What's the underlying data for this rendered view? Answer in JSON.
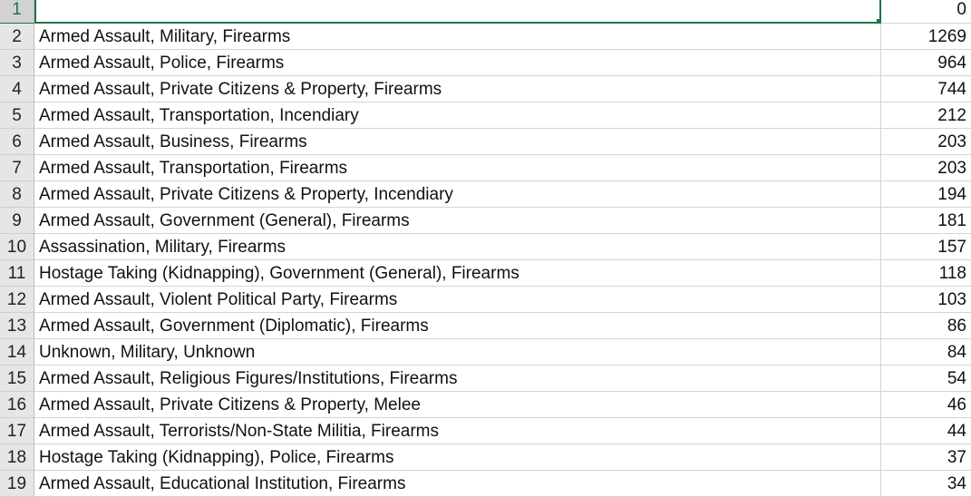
{
  "rows": [
    {
      "n": "1",
      "label": "",
      "value": "0"
    },
    {
      "n": "2",
      "label": "Armed Assault, Military, Firearms",
      "value": "1269"
    },
    {
      "n": "3",
      "label": "Armed Assault, Police, Firearms",
      "value": "964"
    },
    {
      "n": "4",
      "label": "Armed Assault, Private Citizens & Property, Firearms",
      "value": "744"
    },
    {
      "n": "5",
      "label": "Armed Assault, Transportation, Incendiary",
      "value": "212"
    },
    {
      "n": "6",
      "label": "Armed Assault, Business, Firearms",
      "value": "203"
    },
    {
      "n": "7",
      "label": "Armed Assault, Transportation, Firearms",
      "value": "203"
    },
    {
      "n": "8",
      "label": "Armed Assault, Private Citizens & Property, Incendiary",
      "value": "194"
    },
    {
      "n": "9",
      "label": "Armed Assault, Government (General), Firearms",
      "value": "181"
    },
    {
      "n": "10",
      "label": "Assassination, Military, Firearms",
      "value": "157"
    },
    {
      "n": "11",
      "label": "Hostage Taking (Kidnapping), Government (General), Firearms",
      "value": "118"
    },
    {
      "n": "12",
      "label": "Armed Assault, Violent Political Party, Firearms",
      "value": "103"
    },
    {
      "n": "13",
      "label": "Armed Assault, Government (Diplomatic), Firearms",
      "value": "86"
    },
    {
      "n": "14",
      "label": "Unknown, Military, Unknown",
      "value": "84"
    },
    {
      "n": "15",
      "label": "Armed Assault, Religious Figures/Institutions, Firearms",
      "value": "54"
    },
    {
      "n": "16",
      "label": "Armed Assault, Private Citizens & Property, Melee",
      "value": "46"
    },
    {
      "n": "17",
      "label": "Armed Assault, Terrorists/Non-State Militia, Firearms",
      "value": "44"
    },
    {
      "n": "18",
      "label": "Hostage Taking (Kidnapping), Police, Firearms",
      "value": "37"
    },
    {
      "n": "19",
      "label": "Armed Assault, Educational Institution, Firearms",
      "value": "34"
    }
  ],
  "colors": {
    "accent": "#217346",
    "header_bg": "#e6e6e6"
  }
}
